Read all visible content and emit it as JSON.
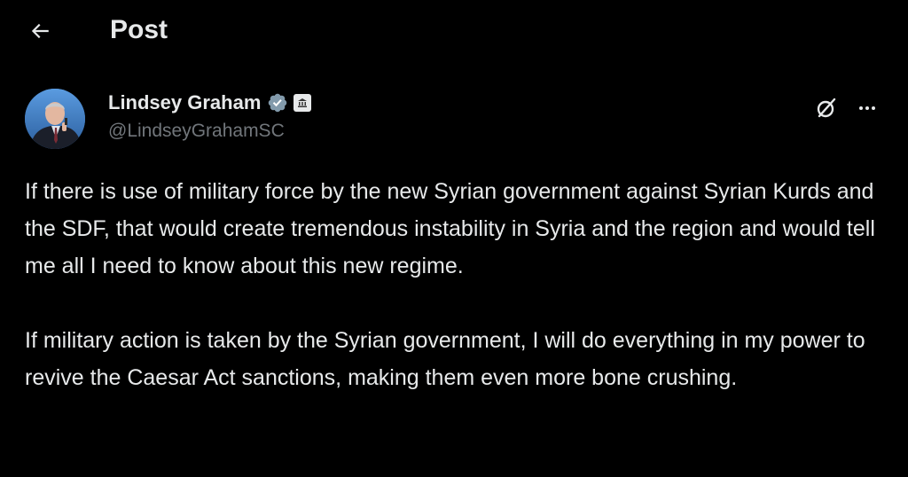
{
  "header": {
    "title": "Post",
    "back_icon": "arrow-left-icon"
  },
  "author": {
    "display_name": "Lindsey Graham",
    "handle": "@LindseyGrahamSC",
    "verified_badge": "gray-verified-badge-icon",
    "affiliate_badge": "government-building-icon"
  },
  "actions": {
    "grok_icon": "grok-icon",
    "more_icon": "more-horizontal-icon"
  },
  "tweet": {
    "paragraphs": [
      "If there is use of military force by the new Syrian government against Syrian Kurds and the SDF, that would create tremendous instability in Syria and the region and would tell me all I need to know about this new regime.",
      "If military action is taken by the Syrian government, I will do everything in my power to revive the Caesar Act sanctions, making them even more bone crushing."
    ]
  },
  "colors": {
    "background": "#000000",
    "text_primary": "#e7e9ea",
    "text_secondary": "#71767b",
    "verified_gray": "#829aab"
  }
}
